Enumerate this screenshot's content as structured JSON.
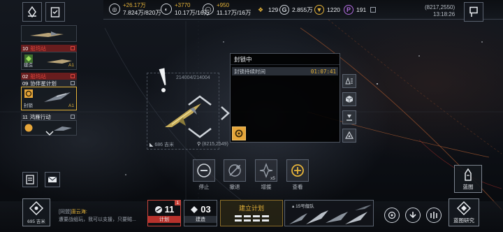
{
  "top": {
    "resources": [
      {
        "icon": "metal-icon",
        "symbol": "◎",
        "delta": "+26.17万",
        "amount": "7.824万/820万"
      },
      {
        "icon": "crystal-icon",
        "symbol": "◐",
        "delta": "+3770",
        "amount": "10.17万/16万"
      },
      {
        "icon": "deuterium-icon",
        "symbol": "◯",
        "delta": "+950",
        "amount": "11.17万/16万"
      }
    ],
    "counts": [
      {
        "icon": "rank-icon",
        "symbol": "❖",
        "value": "129",
        "color": "#e6b43a"
      },
      {
        "icon": "credit-icon",
        "symbol": "G",
        "value": "2.855万",
        "color": "#cfd4da"
      },
      {
        "icon": "gold-coin-icon",
        "symbol": "▼",
        "value": "1220",
        "color": "#e6b43a"
      },
      {
        "icon": "premium-icon",
        "symbol": "P",
        "value": "191",
        "color": "#b26ce0"
      }
    ],
    "coordinates": "(8217,2550)",
    "time": "13:18:26"
  },
  "tasks": [
    {
      "num": "10",
      "title": "船坞站",
      "style": "red",
      "card_label": "建造",
      "card_tag": "A1"
    },
    {
      "num": "02",
      "title": "船坞站",
      "style": "red"
    },
    {
      "num": "09",
      "title": "协伴星计划",
      "style": "grey",
      "card_label": "封锁",
      "card_tag": "A1"
    },
    {
      "num": "11",
      "title": "鸿雁行动",
      "style": "grey"
    }
  ],
  "map": {
    "target_hp": "214004/214004",
    "fleet_distance": "686 吉米",
    "fleet_coords": "(8215,2549)"
  },
  "panel": {
    "title": "封锁中",
    "row_label": "封锁持续时间",
    "timer": "01:07:41"
  },
  "actions": [
    {
      "icon": "stop-icon",
      "label": "停止"
    },
    {
      "icon": "retreat-icon",
      "label": "撤退"
    },
    {
      "icon": "reinforce-icon",
      "label": "增援",
      "badge": "x5"
    },
    {
      "icon": "inspect-icon",
      "label": "查看"
    }
  ],
  "right": {
    "blueprint_label": "蓝图",
    "blueprint_research_label": "蓝图研究"
  },
  "bottom": {
    "distance": "695 吉米",
    "chat_channel": "[同盟]",
    "chat_name": "唐云海:",
    "chat_message": "遭要战组玩，我可以支援，只要贼...",
    "plan_count": "11",
    "plan_badge": "1",
    "plan_label": "计划",
    "build_count": "03",
    "build_label": "建造",
    "build_plan_label": "建立计划",
    "fleet_label": "15号舰队"
  }
}
